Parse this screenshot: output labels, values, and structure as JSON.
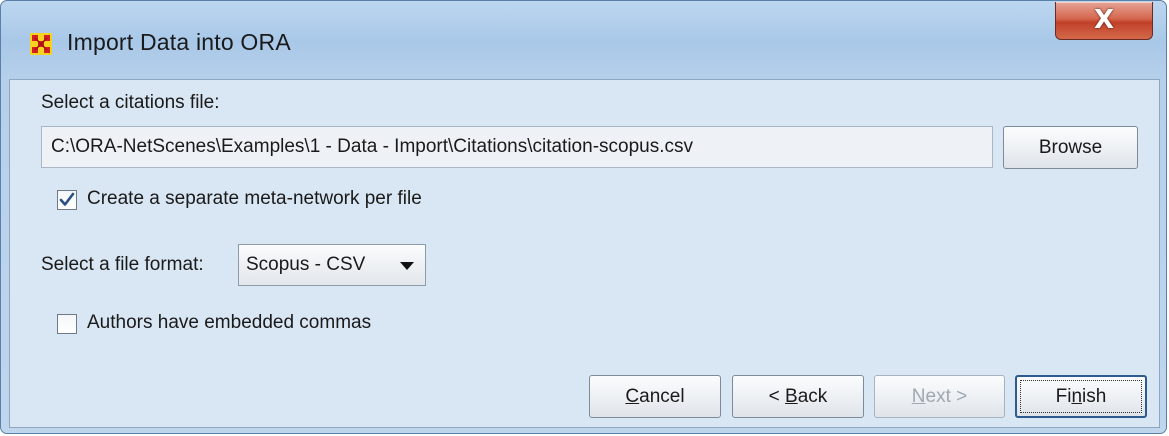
{
  "window": {
    "title": "Import Data into ORA",
    "close_label": "X"
  },
  "citations": {
    "label": "Select a citations file:",
    "path_value": "C:\\ORA-NetScenes\\Examples\\1 - Data - Import\\Citations\\citation-scopus.csv",
    "browse_label": "Browse"
  },
  "options": {
    "separate_network_label": "Create a separate meta-network per file",
    "separate_network_checked": true,
    "embedded_commas_label": "Authors have embedded commas",
    "embedded_commas_checked": false
  },
  "format": {
    "label": "Select a file format:",
    "selected": "Scopus - CSV"
  },
  "buttons": {
    "cancel_pre": "",
    "cancel_mnemonic": "C",
    "cancel_post": "ancel",
    "back_pre": "< ",
    "back_mnemonic": "B",
    "back_post": "ack",
    "next_pre": "",
    "next_mnemonic": "N",
    "next_post": "ext >",
    "finish_pre": "Fi",
    "finish_mnemonic": "n",
    "finish_post": "ish"
  },
  "icons": {
    "app_icon": "ora-network-icon",
    "close_icon": "close-icon",
    "checkmark": "checkmark-icon",
    "dropdown": "chevron-down-icon"
  }
}
